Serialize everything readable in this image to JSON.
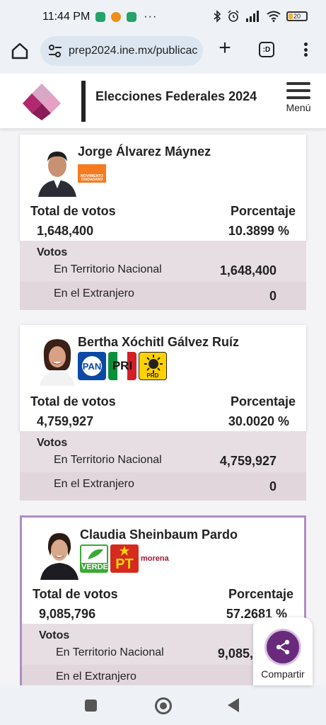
{
  "status_bar": {
    "time": "11:44 PM",
    "battery": "20",
    "icons": [
      "shield-app-icon",
      "orange-app-icon",
      "shield-app-icon",
      "more-dots-icon",
      "bluetooth-icon",
      "alarm-icon",
      "signal-icon",
      "wifi-icon",
      "battery-icon"
    ]
  },
  "browser": {
    "url": "prep2024.ine.mx/publicac",
    "tabs_label": ":D"
  },
  "header": {
    "title": "Elecciones Federales 2024",
    "menu_label": "Menú"
  },
  "candidates": [
    {
      "name": "Jorge Álvarez Máynez",
      "parties": [
        "MOVIMIENTO CIUDADANO"
      ],
      "total_label": "Total de votos",
      "pct_label": "Porcentaje",
      "total": "1,648,400",
      "pct": "10.3899 %",
      "votos_label": "Votos",
      "nacional_label": "En Territorio Nacional",
      "nacional": "1,648,400",
      "extranjero_label": "En el Extranjero",
      "extranjero": "0"
    },
    {
      "name": "Bertha Xóchitl Gálvez Ruíz",
      "parties": [
        "PAN",
        "PRI",
        "PRD"
      ],
      "total_label": "Total de votos",
      "pct_label": "Porcentaje",
      "total": "4,759,927",
      "pct": "30.0020 %",
      "votos_label": "Votos",
      "nacional_label": "En Territorio Nacional",
      "nacional": "4,759,927",
      "extranjero_label": "En el Extranjero",
      "extranjero": "0"
    },
    {
      "name": "Claudia Sheinbaum Pardo",
      "parties": [
        "VERDE",
        "PT",
        "morena"
      ],
      "total_label": "Total de votos",
      "pct_label": "Porcentaje",
      "total": "9,085,796",
      "pct": "57.2681 %",
      "votos_label": "Votos",
      "nacional_label": "En Territorio Nacional",
      "nacional": "9,085,796",
      "extranjero_label": "En el Extranjero",
      "extranjero": ""
    }
  ],
  "share": {
    "label": "Compartir"
  },
  "colors": {
    "brand": "#a0236e",
    "accent": "#6a2a7c",
    "winner_border": "#b08cc4",
    "votos_bg": "#e6dee3"
  }
}
